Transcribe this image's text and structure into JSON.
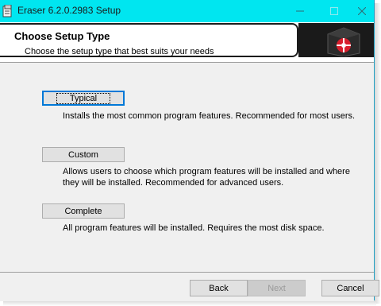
{
  "window": {
    "title": "Eraser 6.2.0.2983 Setup"
  },
  "header": {
    "title": "Choose Setup Type",
    "subtitle": "Choose the setup type that best suits your needs"
  },
  "options": [
    {
      "label": "Typical",
      "description": "Installs the most common program features. Recommended for most users.",
      "focused": true
    },
    {
      "label": "Custom",
      "description": "Allows users to choose which program features will be installed and where they will be installed. Recommended for advanced users.",
      "focused": false
    },
    {
      "label": "Complete",
      "description": "All program features will be installed. Requires the most disk space.",
      "focused": false
    }
  ],
  "footer": {
    "back_label": "Back",
    "next_label": "Next",
    "cancel_label": "Cancel",
    "next_enabled": false
  },
  "colors": {
    "titlebar": "#00e6f0",
    "focus_border": "#0078d7",
    "logo_red": "#d81e2c"
  }
}
